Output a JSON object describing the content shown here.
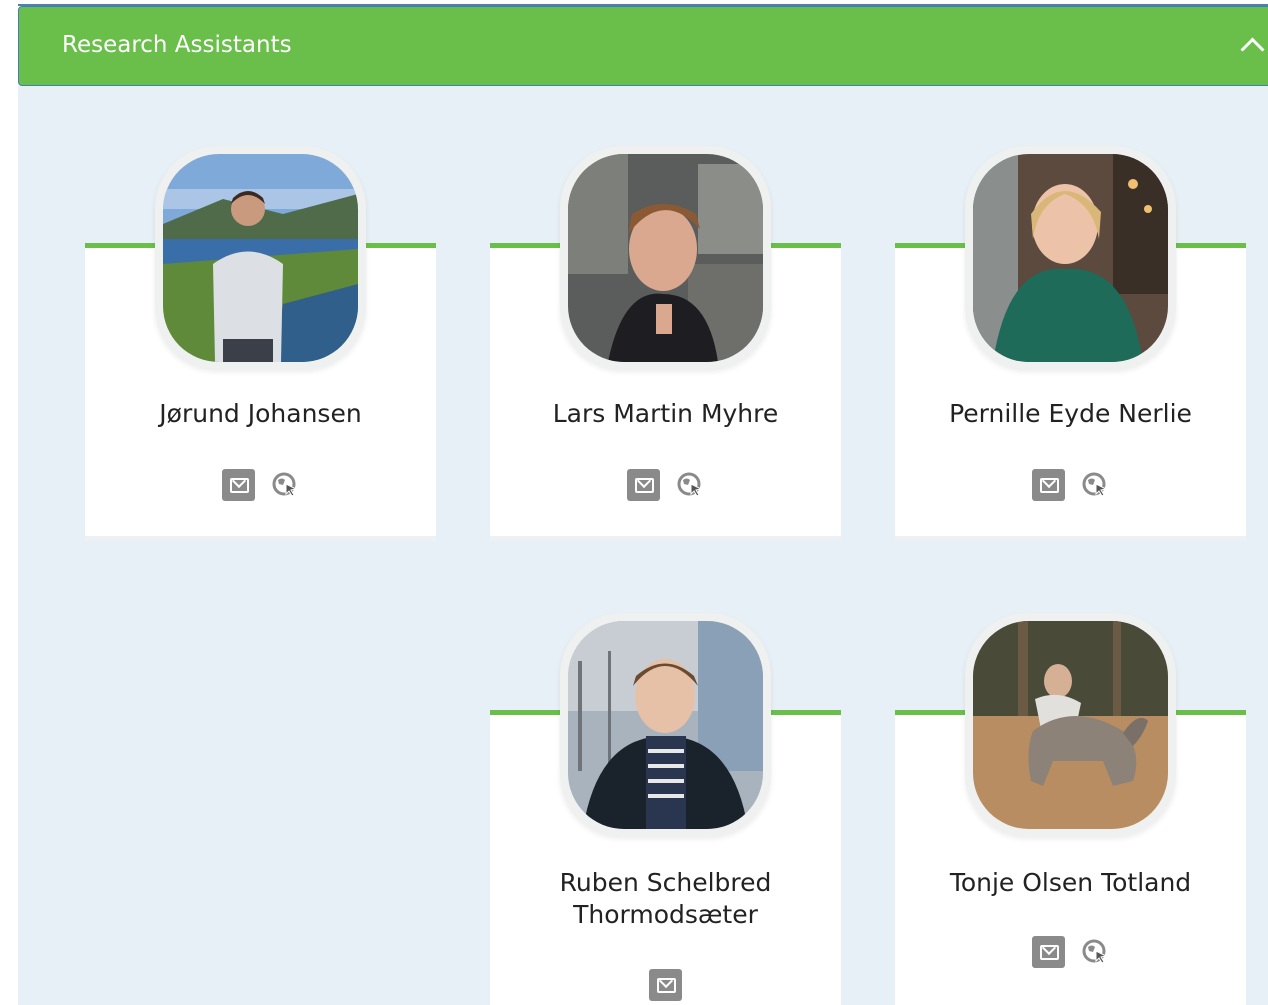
{
  "panel": {
    "title": "Research Assistants",
    "collapse_icon": "chevron-up-icon",
    "accent_color": "#6abf4b",
    "background_color": "#e8f0f7"
  },
  "people": [
    {
      "name": "Jørund Johansen",
      "has_email": true,
      "has_website": true
    },
    {
      "name": "Lars Martin Myhre",
      "has_email": true,
      "has_website": true
    },
    {
      "name": "Pernille Eyde Nerlie",
      "has_email": true,
      "has_website": true
    },
    {
      "name_line1": "Ruben Schelbred",
      "name_line2": "Thormodsæter",
      "has_email": true,
      "has_website": false
    },
    {
      "name": "Tonje Olsen Totland",
      "has_email": true,
      "has_website": true
    }
  ]
}
